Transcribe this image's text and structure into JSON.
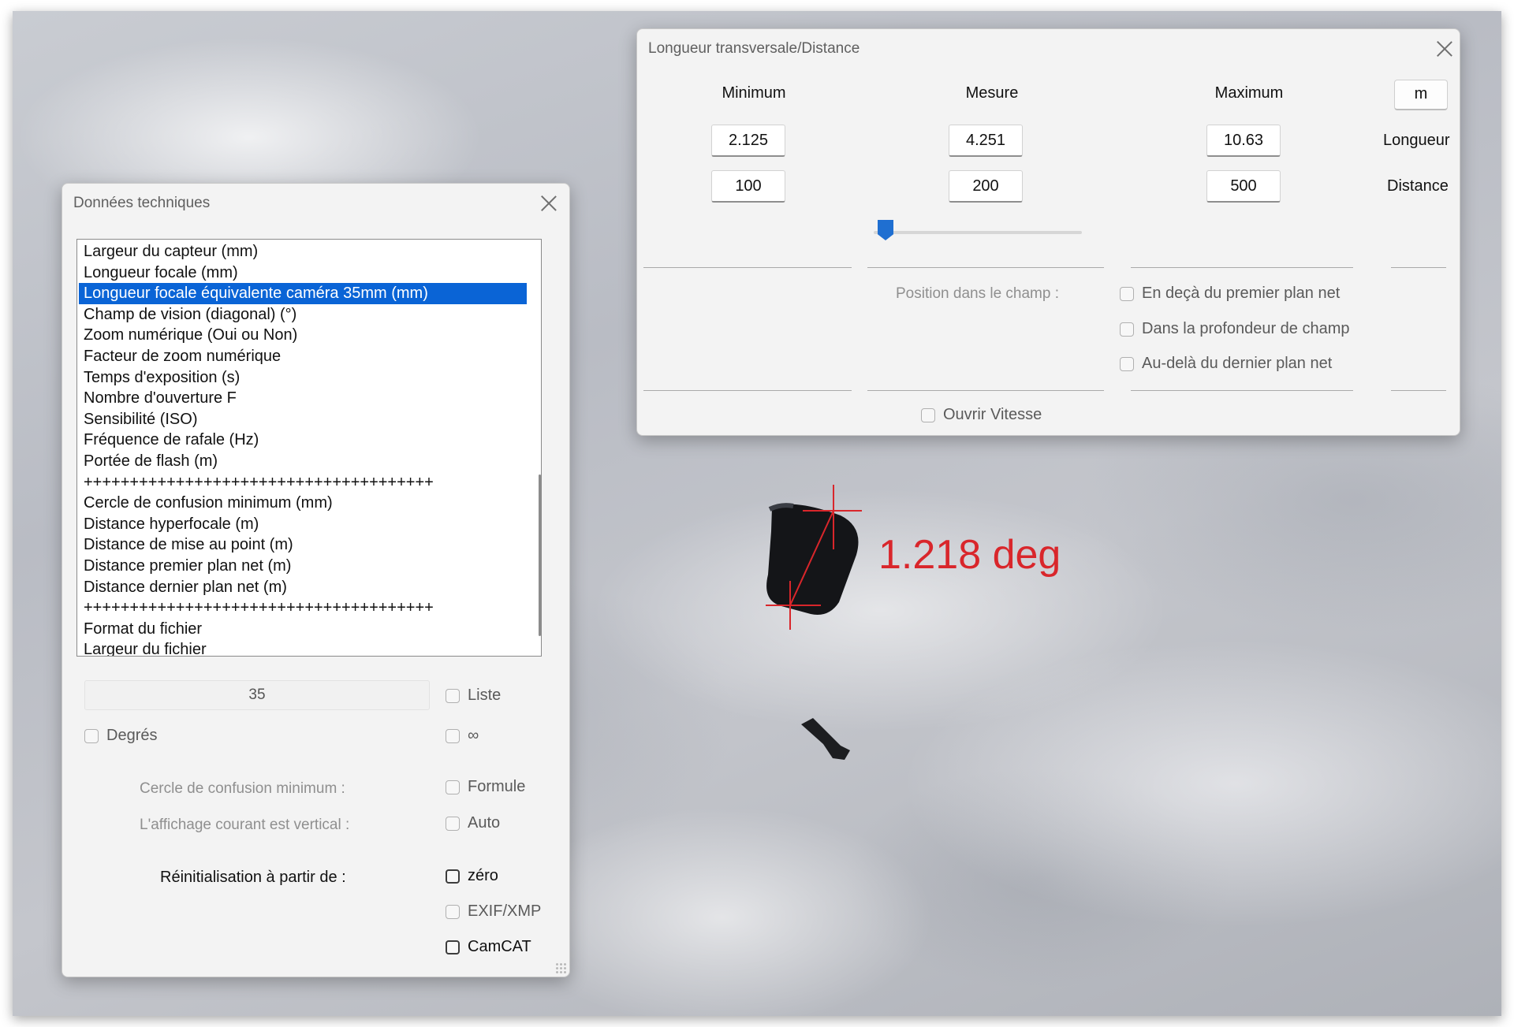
{
  "overlay": {
    "angle_text": "1.218 deg",
    "marker_color": "#d9262b"
  },
  "distance_window": {
    "title": "Longueur transversale/Distance",
    "headers": {
      "minimum": "Minimum",
      "mesure": "Mesure",
      "maximum": "Maximum"
    },
    "unit_button": "m",
    "length": {
      "min": "2.125",
      "mesure": "4.251",
      "max": "10.63",
      "label": "Longueur"
    },
    "distance": {
      "min": "100",
      "mesure": "200",
      "max": "500",
      "label": "Distance"
    },
    "slider_position": 0.03,
    "position_label": "Position dans le champ :",
    "options": [
      {
        "label": "En deçà du premier plan net",
        "checked": false
      },
      {
        "label": "Dans la profondeur de champ",
        "checked": false
      },
      {
        "label": "Au-delà du dernier plan net",
        "checked": false
      }
    ],
    "open_speed": {
      "label": "Ouvrir Vitesse",
      "checked": false
    }
  },
  "tech_window": {
    "title": "Données techniques",
    "list_items": [
      "Largeur du capteur (mm)",
      "Longueur focale (mm)",
      "Longueur focale équivalente caméra 35mm (mm)",
      "Champ de vision (diagonal) (°)",
      "Zoom numérique (Oui ou Non)",
      "Facteur de zoom numérique",
      "Temps d'exposition (s)",
      "Nombre d'ouverture F",
      "Sensibilité (ISO)",
      "Fréquence de rafale (Hz)",
      "Portée de flash (m)",
      "++++++++++++++++++++++++++++++++++++++",
      "Cercle de confusion minimum (mm)",
      "Distance hyperfocale (m)",
      "Distance de mise au point (m)",
      "Distance premier plan net (m)",
      "Distance dernier plan net (m)",
      "++++++++++++++++++++++++++++++++++++++",
      "Format du fichier",
      "Largeur du fichier"
    ],
    "selected_index": 2,
    "value": "35",
    "checkbox_liste": "Liste",
    "checkbox_degres": "Degrés",
    "checkbox_infinity": "∞",
    "coc_label": "Cercle de confusion minimum :",
    "checkbox_formule": "Formule",
    "vertical_label": "L'affichage courant est vertical :",
    "checkbox_auto": "Auto",
    "reset_label": "Réinitialisation à partir de :",
    "checkbox_zero": "zéro",
    "checkbox_exif": "EXIF/XMP",
    "checkbox_camcat": "CamCAT"
  }
}
